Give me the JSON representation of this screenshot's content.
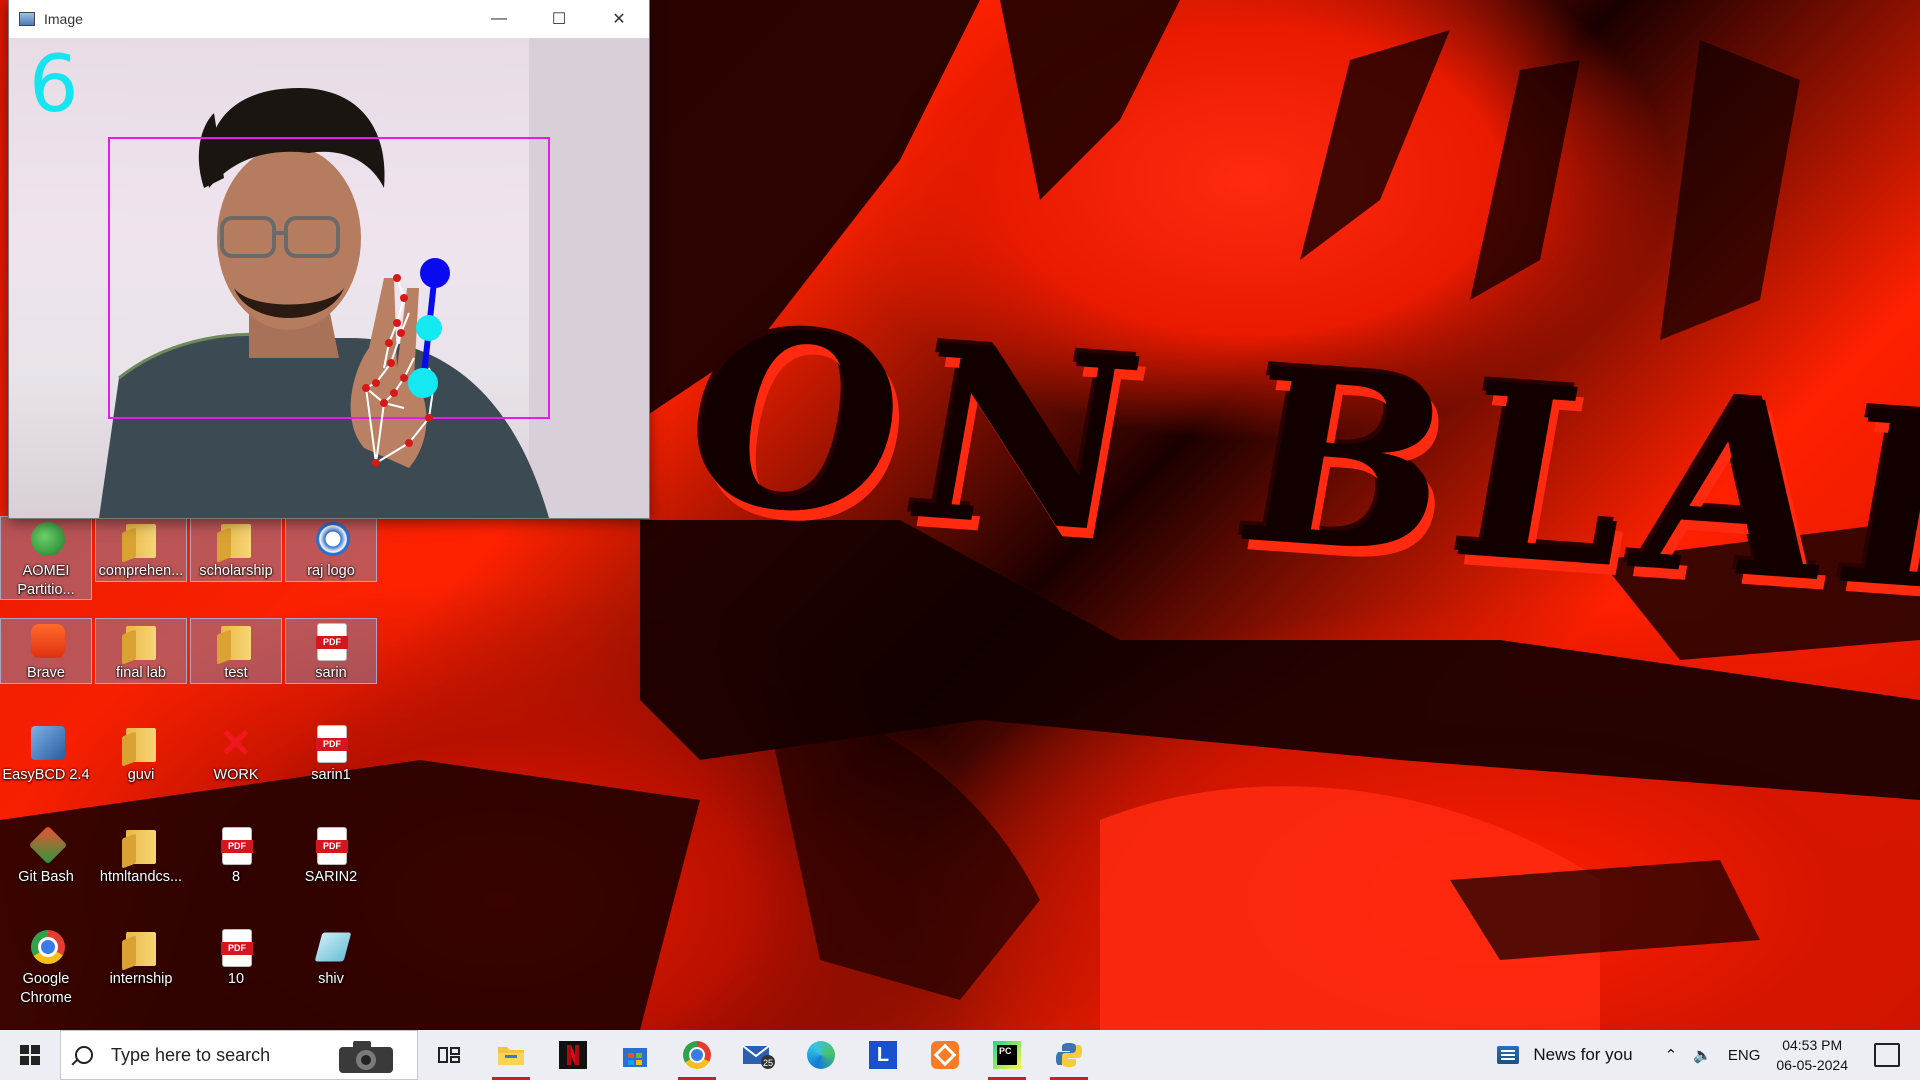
{
  "window": {
    "title": "Image",
    "controls": [
      "minimize",
      "maximize",
      "close"
    ],
    "counter_value": "6",
    "counter_color": "#16e5f0",
    "bbox_color": "#e020e8",
    "landmark_color": "#d81818",
    "pointer_color": "#0a0af0",
    "pointer_secondary_color": "#14e8f0"
  },
  "wallpaper": {
    "title_text": "ON BLADE",
    "colors": [
      "#ff2200",
      "#0a0000"
    ]
  },
  "desktop_icons": [
    {
      "label": "AOMEI Partitio...",
      "icon": "aomei-icon",
      "selected": true
    },
    {
      "label": "comprehen...",
      "icon": "folder-icon",
      "selected": true
    },
    {
      "label": "scholarship",
      "icon": "folder-icon",
      "selected": true
    },
    {
      "label": "raj logo",
      "icon": "logo-image-icon",
      "selected": true
    },
    {
      "label": "Brave",
      "icon": "brave-icon",
      "selected": true
    },
    {
      "label": "final lab",
      "icon": "folder-icon",
      "selected": true
    },
    {
      "label": "test",
      "icon": "folder-icon",
      "selected": true
    },
    {
      "label": "sarin",
      "icon": "pdf-icon",
      "selected": true
    },
    {
      "label": "EasyBCD 2.4",
      "icon": "easybcd-icon",
      "selected": false
    },
    {
      "label": "guvi",
      "icon": "folder-icon",
      "selected": false
    },
    {
      "label": "WORK",
      "icon": "x-icon",
      "selected": false
    },
    {
      "label": "sarin1",
      "icon": "pdf-icon",
      "selected": false
    },
    {
      "label": "Git Bash",
      "icon": "git-bash-icon",
      "selected": false
    },
    {
      "label": "htmltandcs...",
      "icon": "folder-icon",
      "selected": false
    },
    {
      "label": "8",
      "icon": "pdf-icon",
      "selected": false
    },
    {
      "label": "SARIN2",
      "icon": "pdf-icon",
      "selected": false
    },
    {
      "label": "Google Chrome",
      "icon": "chrome-icon",
      "selected": false
    },
    {
      "label": "internship",
      "icon": "folder-icon",
      "selected": false
    },
    {
      "label": "10",
      "icon": "pdf-icon",
      "selected": false
    },
    {
      "label": "shiv",
      "icon": "shortcut-icon",
      "selected": false
    }
  ],
  "taskbar": {
    "search_placeholder": "Type here to search",
    "pinned": [
      {
        "name": "task-view-icon",
        "active": false
      },
      {
        "name": "file-explorer-icon",
        "active": true
      },
      {
        "name": "netflix-icon",
        "active": false
      },
      {
        "name": "microsoft-store-icon",
        "active": false
      },
      {
        "name": "chrome-icon",
        "active": true
      },
      {
        "name": "mail-icon",
        "active": false,
        "badge": "25"
      },
      {
        "name": "edge-icon",
        "active": false
      },
      {
        "name": "l-app-icon",
        "active": false
      },
      {
        "name": "xampp-icon",
        "active": false
      },
      {
        "name": "pycharm-icon",
        "active": true
      },
      {
        "name": "python-icon",
        "active": true
      }
    ],
    "news": "News for you",
    "language": "ENG",
    "time": "04:53 PM",
    "date": "06-05-2024"
  }
}
